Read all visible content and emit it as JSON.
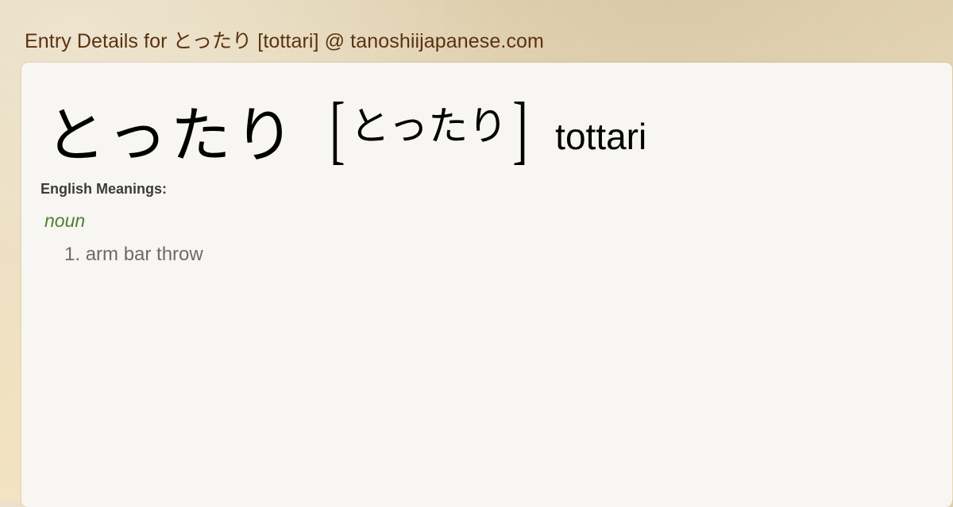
{
  "header": {
    "title": "Entry Details for とったり [tottari] @ tanoshiijapanese.com"
  },
  "entry": {
    "headword": "とったり",
    "reading": "とったり",
    "bracket_open": "[",
    "bracket_close": "]",
    "romaji": "tottari"
  },
  "meanings": {
    "label": "English Meanings:",
    "part_of_speech": "noun",
    "items": [
      {
        "number": "1.",
        "text": "arm bar throw"
      }
    ]
  },
  "colors": {
    "header_text": "#5a3210",
    "pos_text": "#4f7f2c",
    "meaning_text": "#6b6b6b",
    "card_background": "#f7f6f2"
  }
}
